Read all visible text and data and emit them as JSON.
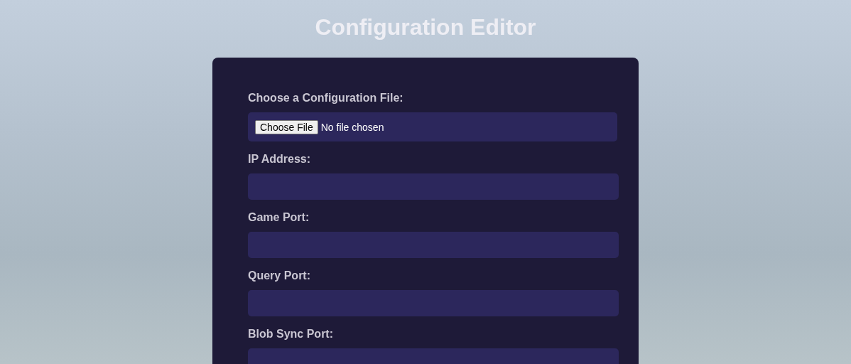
{
  "title": "Configuration Editor",
  "fields": [
    {
      "kind": "file",
      "label": "Choose a Configuration File:",
      "button": "Choose File",
      "status": "No file chosen"
    },
    {
      "kind": "text",
      "label": "IP Address:"
    },
    {
      "kind": "text",
      "label": "Game Port:"
    },
    {
      "kind": "text",
      "label": "Query Port:"
    },
    {
      "kind": "text",
      "label": "Blob Sync Port:"
    }
  ]
}
